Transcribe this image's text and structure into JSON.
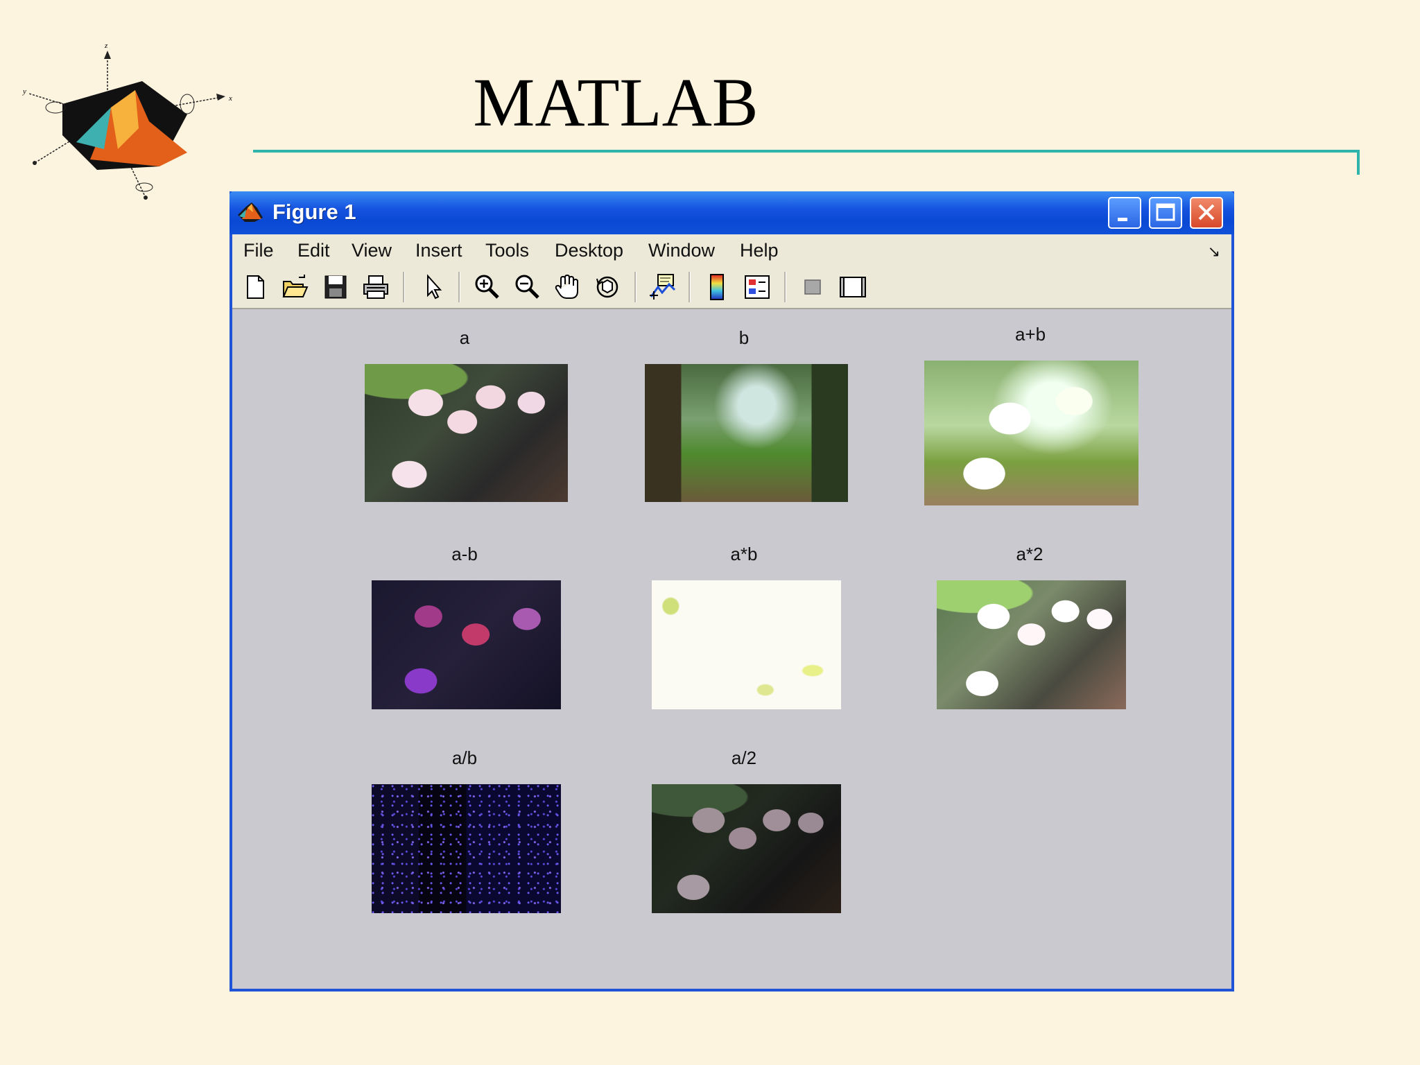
{
  "slide": {
    "title": "MATLAB"
  },
  "window": {
    "title": "Figure 1",
    "buttons": [
      "minimize",
      "maximize",
      "close"
    ]
  },
  "menu": [
    "File",
    "Edit",
    "View",
    "Insert",
    "Tools",
    "Desktop",
    "Window",
    "Help"
  ],
  "toolbar": [
    "new-figure-icon",
    "open-file-icon",
    "save-icon",
    "print-icon",
    "edit-plot-arrow-icon",
    "zoom-in-icon",
    "zoom-out-icon",
    "pan-hand-icon",
    "rotate-3d-icon",
    "data-cursor-icon",
    "insert-colorbar-icon",
    "insert-legend-icon",
    "hide-plot-tools-icon",
    "show-plot-tools-icon"
  ],
  "subplots": [
    {
      "title": "a",
      "image": "flower"
    },
    {
      "title": "b",
      "image": "forest"
    },
    {
      "title": "a+b",
      "image": "sum"
    },
    {
      "title": "a-b",
      "image": "difference"
    },
    {
      "title": "a*b",
      "image": "product"
    },
    {
      "title": "a*2",
      "image": "doubled"
    },
    {
      "title": "a/b",
      "image": "quotient"
    },
    {
      "title": "a/2",
      "image": "halved"
    }
  ]
}
